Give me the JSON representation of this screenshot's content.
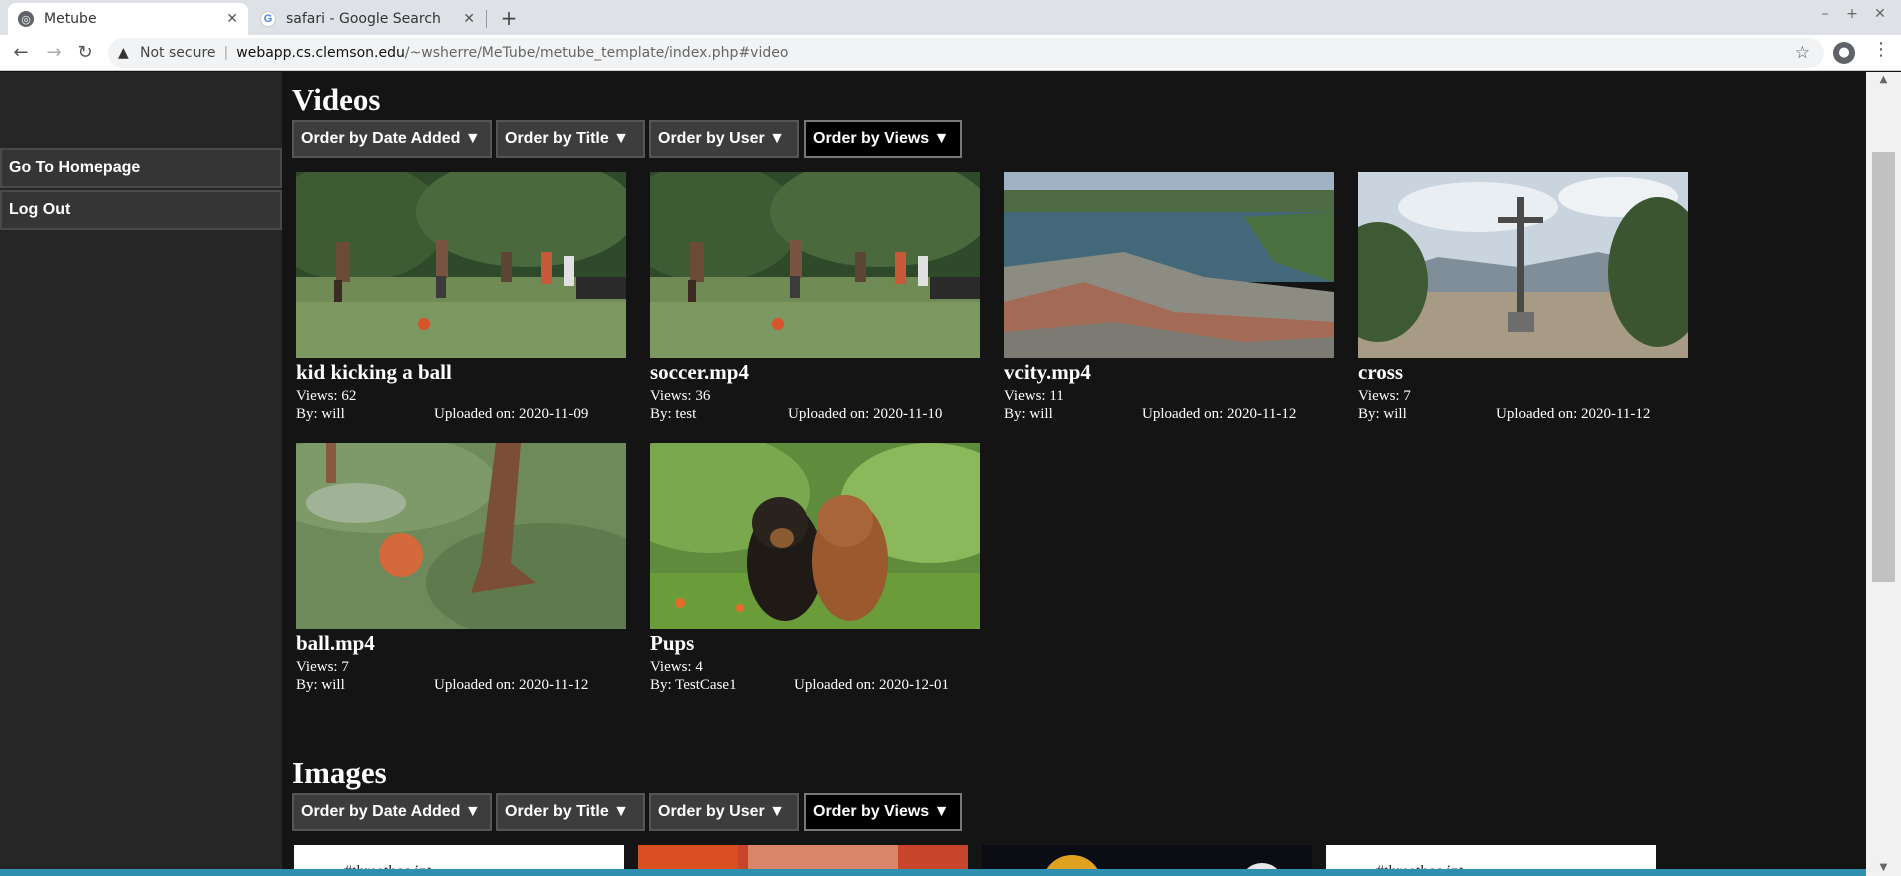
{
  "browser": {
    "tabs": [
      {
        "title": "Metube",
        "active": true,
        "icon": "globe-icon"
      },
      {
        "title": "safari - Google Search",
        "active": false,
        "icon": "google-icon"
      }
    ],
    "address": {
      "security_label": "Not secure",
      "host": "webapp.cs.clemson.edu",
      "path": "/~wsherre/MeTube/metube_template/index.php#video"
    }
  },
  "sidebar": {
    "items": [
      {
        "label": "Go To Homepage"
      },
      {
        "label": "Log Out"
      }
    ]
  },
  "videos": {
    "heading": "Videos",
    "sort_buttons": [
      {
        "label": "Order by Date Added ▼"
      },
      {
        "label": "Order by Title ▼"
      },
      {
        "label": "Order by User ▼"
      },
      {
        "label": "Order by Views ▼",
        "active": true
      }
    ],
    "items": [
      {
        "title": "kid kicking a ball",
        "views": "Views: 62",
        "by": "By: will",
        "uploaded": "Uploaded on: 2020-11-09"
      },
      {
        "title": "soccer.mp4",
        "views": "Views: 36",
        "by": "By: test",
        "uploaded": "Uploaded on: 2020-11-10"
      },
      {
        "title": "vcity.mp4",
        "views": "Views: 11",
        "by": "By: will",
        "uploaded": "Uploaded on: 2020-11-12"
      },
      {
        "title": "cross",
        "views": "Views: 7",
        "by": "By: will",
        "uploaded": "Uploaded on: 2020-11-12"
      },
      {
        "title": "ball.mp4",
        "views": "Views: 7",
        "by": "By: will",
        "uploaded": "Uploaded on: 2020-11-12"
      },
      {
        "title": "Pups",
        "views": "Views: 4",
        "by": "By: TestCase1",
        "uploaded": "Uploaded on: 2020-12-01"
      }
    ]
  },
  "images": {
    "heading": "Images",
    "sort_buttons": [
      {
        "label": "Order by Date Added ▼"
      },
      {
        "label": "Order by Title ▼"
      },
      {
        "label": "Order by User ▼"
      },
      {
        "label": "Order by Views ▼",
        "active": true
      }
    ],
    "tiles": [
      {
        "text": "#threethos.int"
      },
      {
        "text": ""
      },
      {
        "text": ""
      },
      {
        "text": "#threethos.int"
      }
    ]
  },
  "colors": {
    "page_bg": "#141414",
    "sidebar_bg": "#262626",
    "button_bg": "#3d3d3d",
    "active_button_bg": "#000000",
    "accent_strip": "#2f8fae"
  }
}
